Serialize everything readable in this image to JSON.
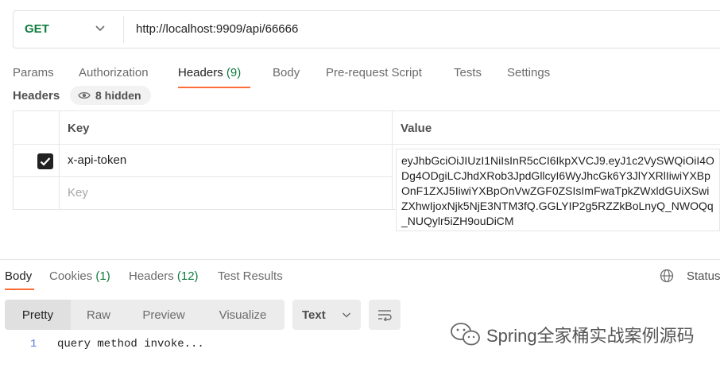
{
  "request": {
    "method": "GET",
    "url": "http://localhost:9909/api/66666"
  },
  "request_tabs": [
    {
      "label": "Params",
      "count": ""
    },
    {
      "label": "Authorization",
      "count": ""
    },
    {
      "label": "Headers",
      "count": "(9)"
    },
    {
      "label": "Body",
      "count": ""
    },
    {
      "label": "Pre-request Script",
      "count": ""
    },
    {
      "label": "Tests",
      "count": ""
    },
    {
      "label": "Settings",
      "count": ""
    }
  ],
  "active_request_tab": "Headers",
  "headers_section": {
    "title": "Headers",
    "hidden_label": "8 hidden"
  },
  "table": {
    "columns": [
      "Key",
      "Value"
    ],
    "rows": [
      {
        "checked": true,
        "key": "x-api-token",
        "value": "eyJhbGciOiJIUzI1NiIsInR5cCI6IkpXVCJ9.eyJ1c2VySWQiOiI4ODg4ODgiLCJhdXRob3JpdGllcyI6WyJhcGk6Y3JlYXRlIiwiYXBpOnF1ZXJ5IiwiYXBpOnVwZGF0ZSIsImFwaTpkZWxldGUiXSwiZXhwIjoxNjk5NjE3NTM3fQ.GGLYIP2g5RZZkBoLnyQ_NWOQq_NUQylr5iZH9ouDiCM"
      }
    ],
    "key_placeholder": "Key"
  },
  "response_tabs": [
    {
      "label": "Body",
      "count": ""
    },
    {
      "label": "Cookies",
      "count": "(1)"
    },
    {
      "label": "Headers",
      "count": "(12)"
    },
    {
      "label": "Test Results",
      "count": ""
    }
  ],
  "status_label": "Status",
  "view_modes": [
    "Pretty",
    "Raw",
    "Preview",
    "Visualize"
  ],
  "active_view_mode": "Pretty",
  "format_select": "Text",
  "response_body": [
    {
      "line": "1",
      "text": "query method invoke..."
    }
  ],
  "watermark": "Spring全家桶实战案例源码",
  "colors": {
    "method_green": "#0f7b3d",
    "accent_orange": "#ff6c37",
    "count_green": "#0f7b3d"
  }
}
